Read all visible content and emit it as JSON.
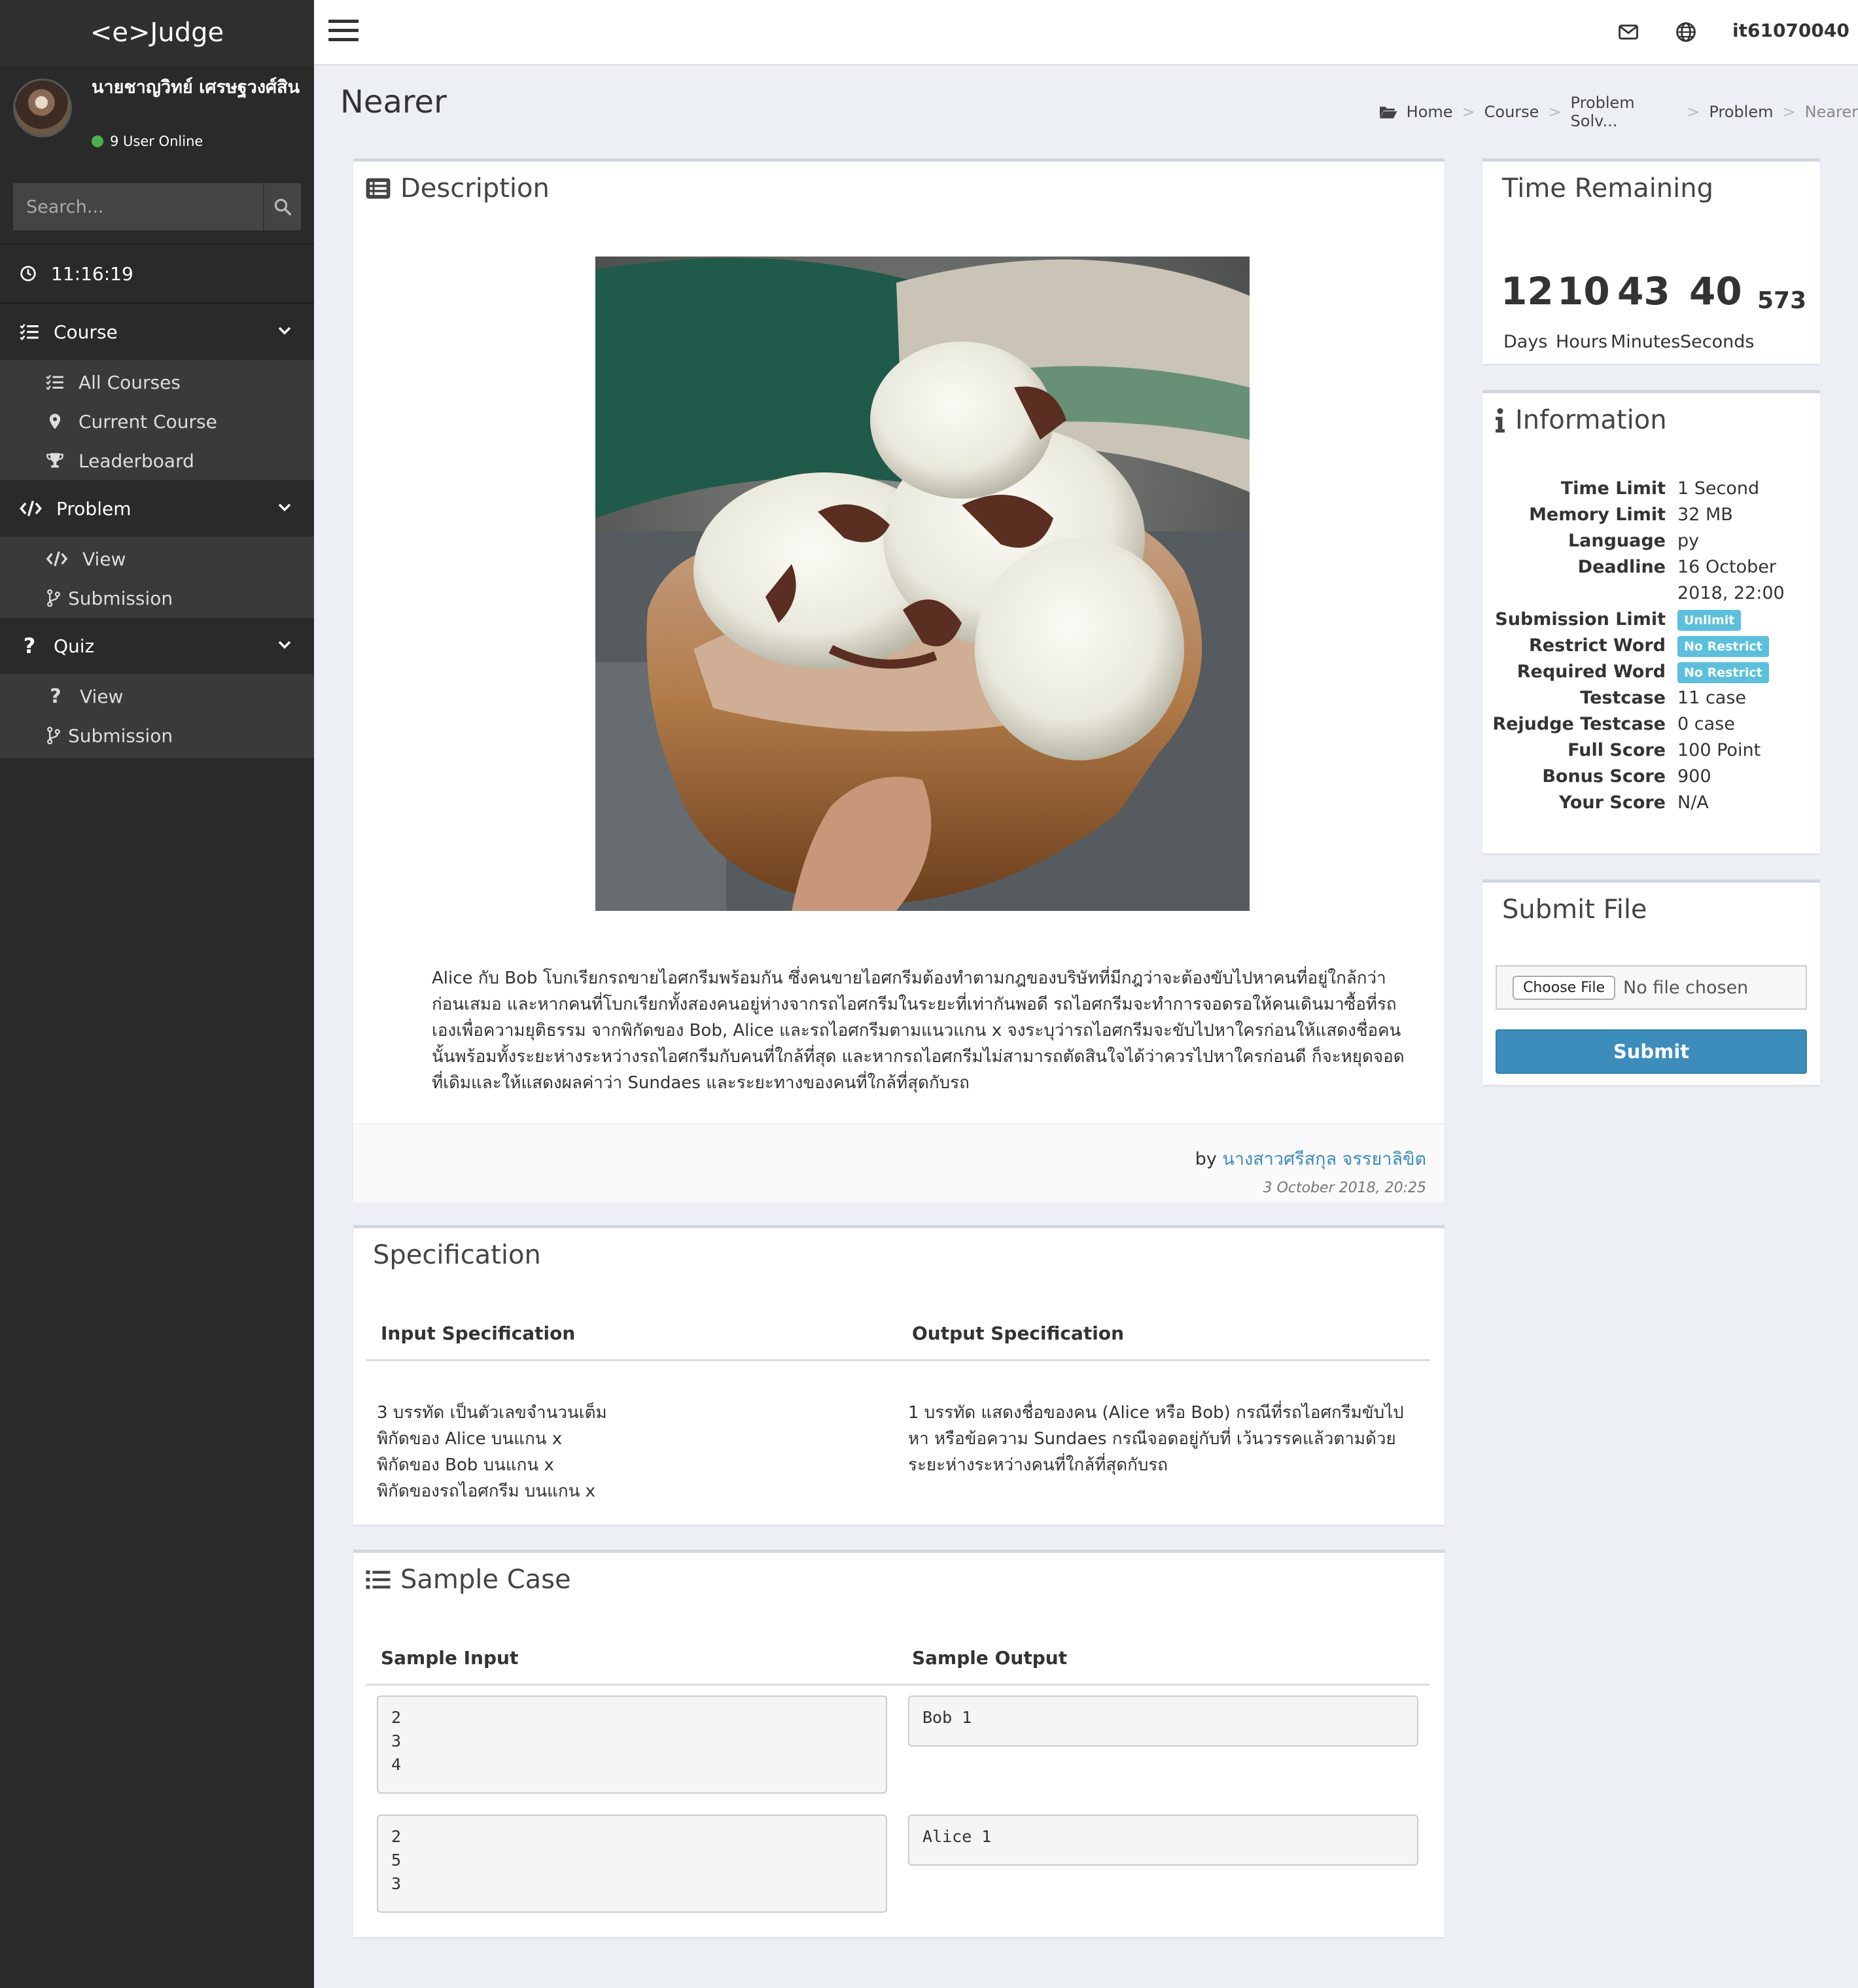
{
  "app": {
    "logo": "<e>Judge"
  },
  "user": {
    "name": "นายชาญวิทย์ เศรษฐวงศ์สิน",
    "online": "9 User Online",
    "username": "it61070040"
  },
  "sidebar": {
    "search_placeholder": "Search...",
    "clock": "11:16:19",
    "course": {
      "label": "Course",
      "items": [
        "All Courses",
        "Current Course",
        "Leaderboard"
      ]
    },
    "problem": {
      "label": "Problem",
      "items": [
        "View",
        "Submission"
      ]
    },
    "quiz": {
      "label": "Quiz",
      "items": [
        "View",
        "Submission"
      ]
    }
  },
  "page": {
    "title": "Nearer",
    "breadcrumb": [
      "Home",
      "Course",
      "Problem Solv...",
      "Problem",
      "Nearer"
    ]
  },
  "description": {
    "title": "Description",
    "text_lines": [
      "Alice กับ Bob โบกเรียกรถขายไอศกรีมพร้อมกัน ซึ่งคนขายไอศกรีมต้องทำตามกฎของบริษัทที่มีกฎว่าจะต้องขับไปหาคนที่อยู่ใกล้กว่า",
      "ก่อนเสมอ และหากคนที่โบกเรียกทั้งสองคนอยู่ห่างจากรถไอศกรีมในระยะที่เท่ากันพอดี รถไอศกรีมจะทำการจอดรอให้คนเดินมาซื้อที่รถ",
      "เองเพื่อความยุติธรรม จากพิกัดของ Bob, Alice และรถไอศกรีมตามแนวแกน x จงระบุว่ารถไอศกรีมจะขับไปหาใครก่อนให้แสดงชื่อคน",
      "นั้นพร้อมทั้งระยะห่างระหว่างรถไอศกรีมกับคนที่ใกล้ที่สุด และหากรถไอศกรีมไม่สามารถตัดสินใจได้ว่าควรไปหาใครก่อนดี ก็จะหยุดจอด",
      "ที่เดิมและให้แสดงผลค่าว่า Sundaes และระยะทางของคนที่ใกล้ที่สุดกับรถ"
    ],
    "by": "by",
    "author": "นางสาวศรีสกุล จรรยาลิขิต",
    "date": "3 October 2018, 20:25"
  },
  "specification": {
    "title": "Specification",
    "input_header": "Input Specification",
    "output_header": "Output Specification",
    "input_lines": [
      "3 บรรทัด เป็นตัวเลขจำนวนเต็ม",
      "พิกัดของ Alice บนแกน x",
      "พิกัดของ Bob บนแกน x",
      "พิกัดของรถไอศกรีม บนแกน x"
    ],
    "output_lines": [
      "1 บรรทัด แสดงชื่อของคน (Alice หรือ Bob) กรณีที่รถไอศกรีมขับไป",
      "หา หรือข้อความ Sundaes กรณีจอดอยู่กับที่ เว้นวรรคแล้วตามด้วย",
      "ระยะห่างระหว่างคนที่ใกล้ที่สุดกับรถ"
    ]
  },
  "sample": {
    "title": "Sample Case",
    "input_header": "Sample Input",
    "output_header": "Sample Output",
    "cases": [
      {
        "input": "2\n3\n4",
        "output": "Bob 1"
      },
      {
        "input": "2\n5\n3",
        "output": "Alice 1"
      }
    ]
  },
  "timer": {
    "title": "Time Remaining",
    "days": "12",
    "hours": "10",
    "minutes": "43",
    "seconds": "40",
    "ms": "573",
    "labels": {
      "days": "Days",
      "hours": "Hours",
      "minutes": "Minutes",
      "seconds": "Seconds"
    }
  },
  "information": {
    "title": "Information",
    "rows": [
      {
        "key": "Time Limit",
        "value": "1 Second"
      },
      {
        "key": "Memory Limit",
        "value": "32 MB"
      },
      {
        "key": "Language",
        "value": "py"
      },
      {
        "key": "Deadline",
        "value": "16 October",
        "value2": "2018, 22:00"
      },
      {
        "key": "Submission Limit",
        "badge": "Unlimit"
      },
      {
        "key": "Restrict Word",
        "badge": "No Restrict"
      },
      {
        "key": "Required Word",
        "badge": "No Restrict"
      },
      {
        "key": "Testcase",
        "value": "11 case"
      },
      {
        "key": "Rejudge Testcase",
        "value": "0 case"
      },
      {
        "key": "Full Score",
        "value": "100 Point"
      },
      {
        "key": "Bonus Score",
        "value": "900"
      },
      {
        "key": "Your Score",
        "value": "N/A"
      }
    ]
  },
  "submit": {
    "title": "Submit File",
    "choose": "Choose File",
    "no_file": "No file chosen",
    "button": "Submit"
  },
  "colors": {
    "accent": "#3c8dbc",
    "badge": "#5bc0de",
    "sidebar": "#2a2a2a",
    "online": "#4caf50"
  }
}
